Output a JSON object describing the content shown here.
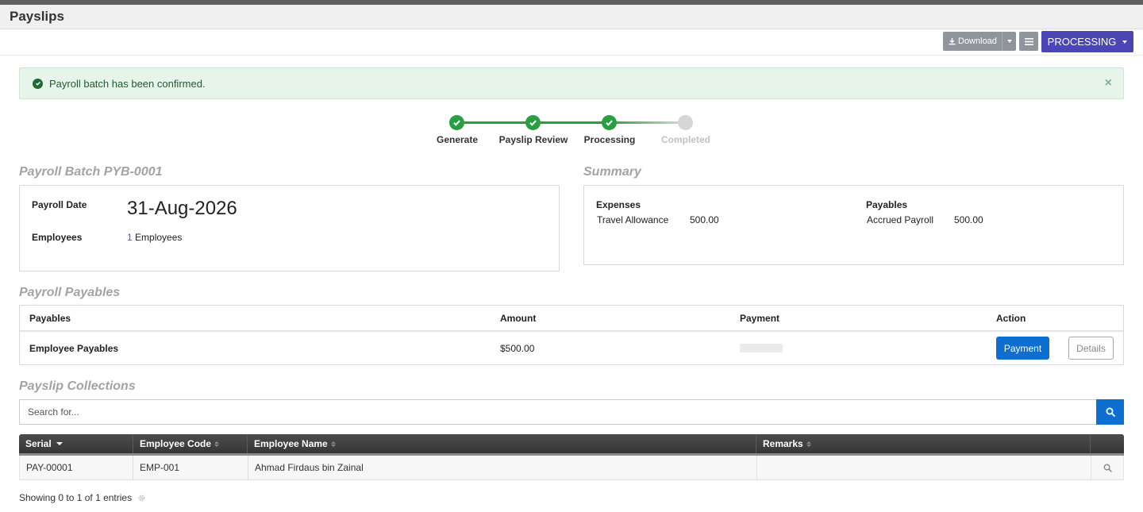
{
  "page": {
    "title": "Payslips"
  },
  "toolbar": {
    "download_label": "Download",
    "status_label": "PROCESSING"
  },
  "alert": {
    "message": "Payroll batch has been confirmed.",
    "close": "×"
  },
  "stepper": {
    "steps": [
      {
        "label": "Generate",
        "state": "done"
      },
      {
        "label": "Payslip Review",
        "state": "done"
      },
      {
        "label": "Processing",
        "state": "done"
      },
      {
        "label": "Completed",
        "state": "todo"
      }
    ]
  },
  "batch": {
    "title": "Payroll Batch PYB-0001",
    "date_label": "Payroll Date",
    "date_value": "31-Aug-2026",
    "employees_label": "Employees",
    "employees_count": "1",
    "employees_suffix": "Employees"
  },
  "summary": {
    "title": "Summary",
    "expenses_label": "Expenses",
    "expense_name": "Travel Allowance",
    "expense_amount": "500.00",
    "payables_label": "Payables",
    "payable_name": "Accrued Payroll",
    "payable_amount": "500.00"
  },
  "payables": {
    "title": "Payroll Payables",
    "columns": [
      "Payables",
      "Amount",
      "Payment",
      "Action"
    ],
    "row": {
      "name": "Employee Payables",
      "amount": "$500.00",
      "payment_button": "Payment",
      "details_button": "Details"
    }
  },
  "collections": {
    "title": "Payslip Collections",
    "search_placeholder": "Search for...",
    "columns": [
      "Serial",
      "Employee Code",
      "Employee Name",
      "Remarks"
    ],
    "rows": [
      {
        "serial": "PAY-00001",
        "code": "EMP-001",
        "name": "Ahmad Firdaus bin Zainal",
        "remarks": ""
      }
    ],
    "footer": "Showing 0 to 1 of 1 entries"
  },
  "colors": {
    "accent": "#4b45b6",
    "primary": "#0c6fd1",
    "success": "#27a043"
  }
}
